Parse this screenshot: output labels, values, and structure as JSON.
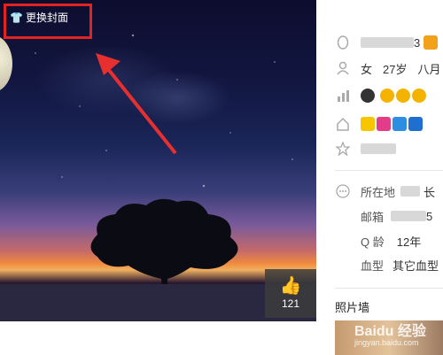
{
  "cover": {
    "change_cover_label": "更换封面",
    "like_count": "121",
    "colors": {
      "highlight": "#e32222",
      "arrow": "#e63030"
    }
  },
  "profile": {
    "name_suffix": "3",
    "gender": "女",
    "age": "27岁",
    "birthday_month": "八月",
    "location_label": "所在地",
    "location_value_suffix": "长",
    "email_label": "邮箱",
    "email_value_suffix": "5",
    "qage_label": "Q 龄",
    "qage_value": "12年",
    "blood_label": "血型",
    "blood_value": "其它血型"
  },
  "photo_wall": {
    "title": "照片墙"
  },
  "watermark": {
    "text": "Baidu 经验",
    "url": "jingyan.baidu.com"
  },
  "icons": [
    "shirt-icon",
    "thumb-up-icon",
    "qq-penguin-icon",
    "person-icon",
    "level-chart-icon",
    "home-icon",
    "star-icon",
    "more-icon"
  ]
}
